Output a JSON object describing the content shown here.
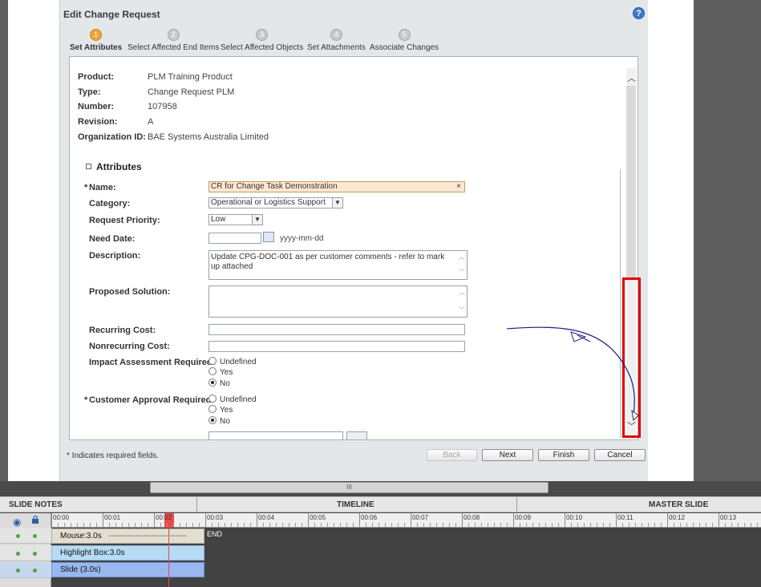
{
  "dialog": {
    "title": "Edit Change Request",
    "steps": [
      {
        "num": "1",
        "label": "Set Attributes"
      },
      {
        "num": "2",
        "label": "Select Affected End Items"
      },
      {
        "num": "3",
        "label": "Select Affected Objects"
      },
      {
        "num": "4",
        "label": "Set Attachments"
      },
      {
        "num": "5",
        "label": "Associate Changes"
      }
    ],
    "header_fields": [
      {
        "label": "Product:",
        "value": "PLM Training Product"
      },
      {
        "label": "Type:",
        "value": "Change Request  PLM"
      },
      {
        "label": "Number:",
        "value": "107958"
      },
      {
        "label": "Revision:",
        "value": "A"
      },
      {
        "label": "Organization ID:",
        "value": "BAE Systems Australia Limited"
      }
    ],
    "section_title": "Attributes",
    "fields": {
      "name_label": "Name:",
      "name_value": "CR for Change Task Demonstration",
      "name_clear": "×",
      "category_label": "Category:",
      "category_value": "Operational or Logistics Support",
      "priority_label": "Request Priority:",
      "priority_value": "Low",
      "need_date_label": "Need Date:",
      "need_date_value": "",
      "date_hint": "yyyy-mm-dd",
      "description_label": "Description:",
      "description_value": "Update CPG-DOC-001 as per customer comments - refer to mark up attached",
      "proposed_label": "Proposed Solution:",
      "proposed_value": "",
      "recurring_label": "Recurring Cost:",
      "recurring_value": "",
      "nonrecurring_label": "Nonrecurring Cost:",
      "nonrecurring_value": "",
      "impact_label": "Impact Assessment Required:",
      "customer_label": "Customer Approval Required:",
      "radio_options": [
        "Undefined",
        "Yes",
        "No"
      ],
      "impact_selected": "No",
      "customer_selected": "No",
      "required_marker": "*"
    },
    "footer": {
      "required_note": "* Indicates required fields.",
      "back": "Back",
      "next": "Next",
      "finish": "Finish",
      "cancel": "Cancel"
    }
  },
  "timeline": {
    "tabs": [
      "SLIDE NOTES",
      "TIMELINE",
      "MASTER SLIDE"
    ],
    "ticks": [
      "00:00",
      "00:01",
      "00:02",
      "00:03",
      "00:04",
      "00:05",
      "00:06",
      "00:07",
      "00:08",
      "00:09",
      "00:10",
      "00:11",
      "00:12",
      "00:13"
    ],
    "tracks": [
      {
        "label": "Mouse:3.0s",
        "dashes": "-----------------------------"
      },
      {
        "label": "Highlight Box:3.0s"
      },
      {
        "label": "Slide (3.0s)"
      }
    ],
    "end_label": "END",
    "splitter_grip": "III"
  },
  "colors": {
    "highlight_border": "#e00000",
    "active_step": "#f2a336",
    "playhead": "#e84a4a",
    "mouse_track": "#e3ded2",
    "highlight_track": "#b7dbf3",
    "slide_track": "#98b8ef",
    "annotation_arrow": "#1b1f80"
  }
}
